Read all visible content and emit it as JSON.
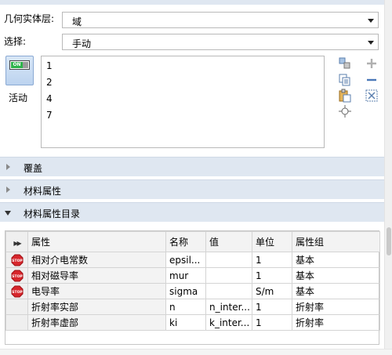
{
  "geometry_layer": {
    "label": "几何实体层:",
    "value": "域"
  },
  "selection": {
    "label": "选择:",
    "value": "手动"
  },
  "active_toggle": {
    "state_text": "ON",
    "label": "活动"
  },
  "selection_list": {
    "items": [
      "1",
      "2",
      "4",
      "7"
    ]
  },
  "sections": {
    "override": "覆盖",
    "material_properties": "材料属性",
    "material_contents": "材料属性目录"
  },
  "table": {
    "columns": [
      "属性",
      "名称",
      "值",
      "单位",
      "属性组"
    ],
    "rows": [
      {
        "stop": true,
        "property": "相对介电常数",
        "name": "epsil...",
        "value": "",
        "unit": "1",
        "group": "基本"
      },
      {
        "stop": true,
        "property": "相对磁导率",
        "name": "mur",
        "value": "",
        "unit": "1",
        "group": "基本"
      },
      {
        "stop": true,
        "property": "电导率",
        "name": "sigma",
        "value": "",
        "unit": "S/m",
        "group": "基本"
      },
      {
        "stop": false,
        "property": "折射率实部",
        "name": "n",
        "value": "n_inter...",
        "unit": "1",
        "group": "折射率"
      },
      {
        "stop": false,
        "property": "折射率虚部",
        "name": "ki",
        "value": "k_inter...",
        "unit": "1",
        "group": "折射率"
      }
    ]
  },
  "colors": {
    "section_bg": "#dfe7f1",
    "stop_red": "#d7262c",
    "toggle_on": "#2eb34a"
  }
}
